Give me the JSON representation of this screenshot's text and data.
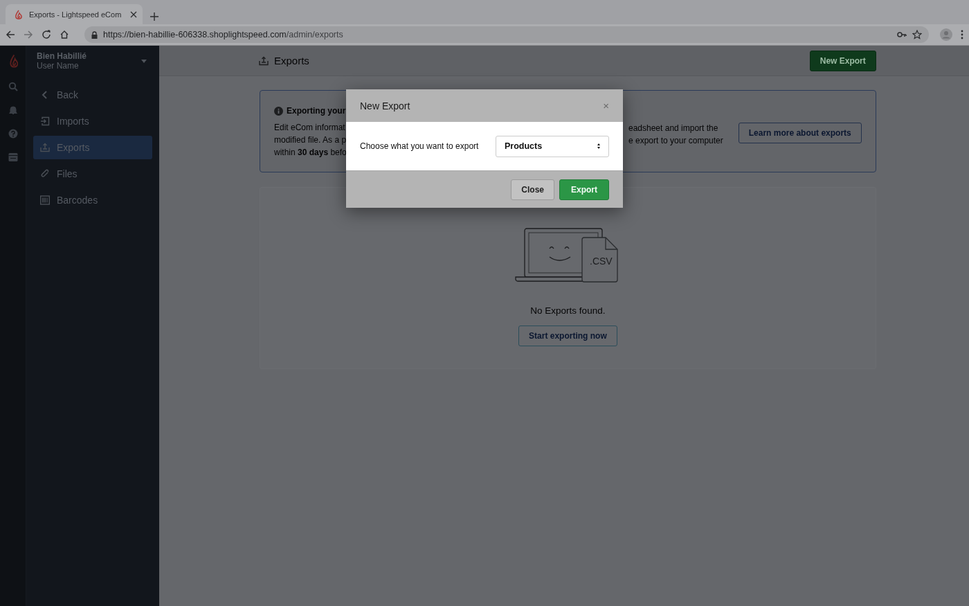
{
  "browser": {
    "tab_title": "Exports - Lightspeed eCom",
    "url_host": "https://bien-habillie-606338.shoplightspeed.com",
    "url_path": "/admin/exports"
  },
  "sidebar": {
    "store_name": "Bien Habillié",
    "user_name": "User Name",
    "items": [
      {
        "label": "Back",
        "kind": "back",
        "selected": false
      },
      {
        "label": "Imports",
        "kind": "import",
        "selected": false
      },
      {
        "label": "Exports",
        "kind": "export",
        "selected": true
      },
      {
        "label": "Files",
        "kind": "clip",
        "selected": false
      },
      {
        "label": "Barcodes",
        "kind": "barcode",
        "selected": false
      }
    ]
  },
  "header": {
    "title": "Exports",
    "button": "New Export"
  },
  "info_card": {
    "title": "Exporting your",
    "lines_left": [
      "Edit eCom informat",
      "modified file. As a p",
      "within **30 days** befo"
    ],
    "lines_right": [
      "eadsheet and import the",
      "e export to your computer"
    ],
    "button": "Learn more about exports"
  },
  "empty_state": {
    "file_label": ".CSV",
    "message": "No Exports found.",
    "button": "Start exporting now"
  },
  "modal": {
    "title": "New Export",
    "close": "×",
    "label": "Choose what you want to export",
    "select_value": "Products",
    "buttons": [
      {
        "label": "Close",
        "kind": "default"
      },
      {
        "label": "Export",
        "kind": "primary"
      }
    ]
  }
}
